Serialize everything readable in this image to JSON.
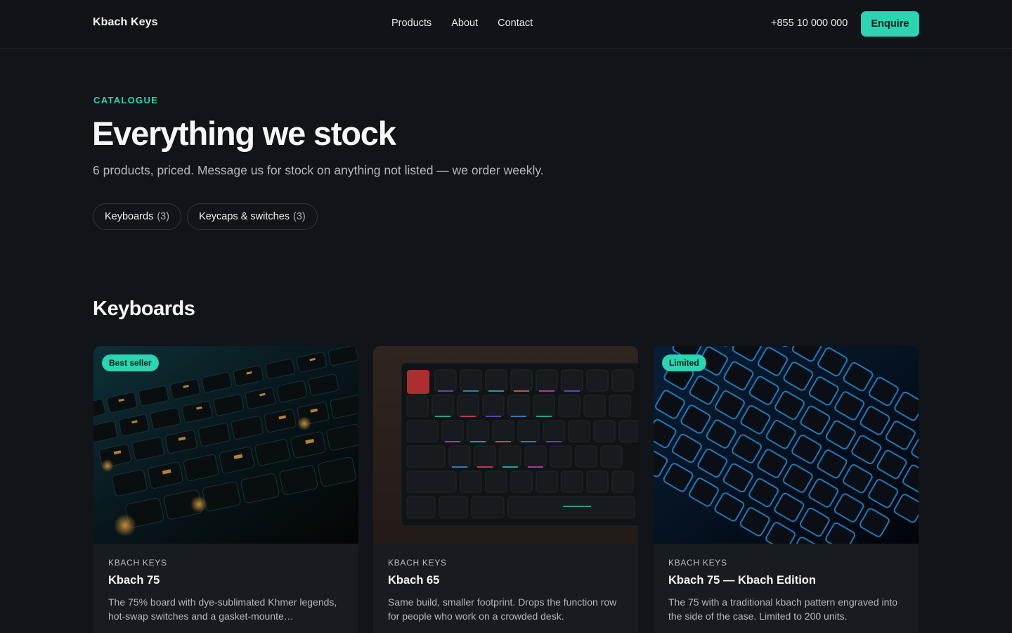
{
  "header": {
    "brand": "Kbach Keys",
    "nav": [
      "Products",
      "About",
      "Contact"
    ],
    "phone": "+855 10 000 000",
    "cta": "Enquire"
  },
  "hero": {
    "eyebrow": "CATALOGUE",
    "title": "Everything we stock",
    "subtitle": "6 products, priced. Message us for stock on anything not listed — we order weekly."
  },
  "filters": [
    {
      "label": "Keyboards",
      "count": "(3)"
    },
    {
      "label": "Keycaps & switches",
      "count": "(3)"
    }
  ],
  "sections": [
    {
      "title": "Keyboards",
      "products": [
        {
          "badge": "Best seller",
          "maker": "KBACH KEYS",
          "name": "Kbach 75",
          "desc": "The 75% board with dye-sublimated Khmer legends, hot-swap switches and a gasket-mounte…",
          "image": "keyboard-amber-backlight-photo"
        },
        {
          "badge": "",
          "maker": "KBACH KEYS",
          "name": "Kbach 65",
          "desc": "Same build, smaller footprint. Drops the function row for people who work on a crowded desk.",
          "image": "keyboard-rgb-desk-photo"
        },
        {
          "badge": "Limited",
          "maker": "KBACH KEYS",
          "name": "Kbach 75 — Kbach Edition",
          "desc": "The 75 with a traditional kbach pattern engraved into the side of the case. Limited to 200 units.",
          "image": "keyboard-blue-backlight-photo"
        }
      ]
    }
  ],
  "colors": {
    "background": "#111418",
    "accent": "#2dd4b2",
    "card": "#181c21"
  }
}
